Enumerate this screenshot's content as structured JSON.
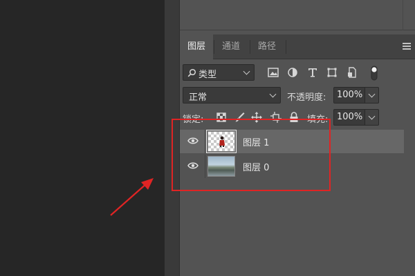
{
  "tabs": [
    {
      "label": "图层",
      "active": true
    },
    {
      "label": "通道",
      "active": false
    },
    {
      "label": "路径",
      "active": false
    }
  ],
  "filter": {
    "kind_label": "类型",
    "icons": [
      "image-filter-icon",
      "adjustment-filter-icon",
      "type-filter-icon",
      "shape-filter-icon",
      "smart-object-filter-icon",
      "filter-toggle-icon"
    ]
  },
  "blend": {
    "mode": "正常",
    "opacity_label": "不透明度:",
    "opacity_value": "100%"
  },
  "lock": {
    "label": "锁定:",
    "icons": [
      "lock-transparent-pixels-icon",
      "lock-image-pixels-icon",
      "lock-position-icon",
      "lock-artboard-icon",
      "lock-all-icon"
    ],
    "fill_label": "填充:",
    "fill_value": "100%"
  },
  "layers": [
    {
      "name": "图层 1",
      "visible": true,
      "selected": true,
      "thumbnail": "transparent"
    },
    {
      "name": "图层 0",
      "visible": true,
      "selected": false,
      "thumbnail": "photo"
    }
  ],
  "colors": {
    "panel_bg": "#535353",
    "selected_layer": "#676767",
    "annotation": "#e02424"
  }
}
